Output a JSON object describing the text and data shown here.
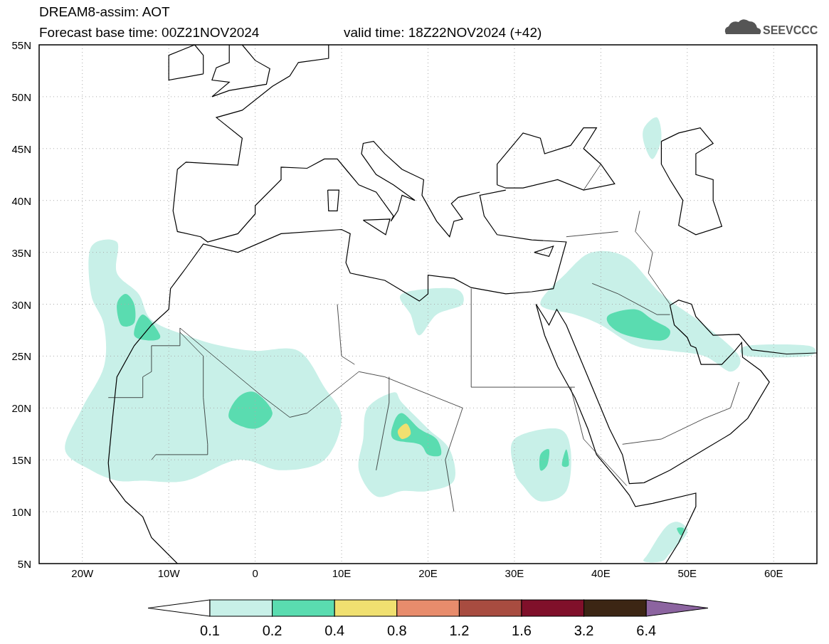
{
  "title": "DREAM8-assim: AOT",
  "base_time": "Forecast base time: 00Z21NOV2024",
  "valid_time": "valid time: 18Z22NOV2024 (+42)",
  "logo": "SEEVCCC",
  "lat_labels": [
    "55N",
    "50N",
    "45N",
    "40N",
    "35N",
    "30N",
    "25N",
    "20N",
    "15N",
    "10N",
    "5N"
  ],
  "lon_labels": [
    "20W",
    "10W",
    "0",
    "10E",
    "20E",
    "30E",
    "40E",
    "50E",
    "60E"
  ],
  "colorbar": {
    "segments": [
      {
        "kind": "under",
        "color": "#ffffff"
      },
      {
        "kind": "box",
        "color": "#c8f0e8"
      },
      {
        "kind": "box",
        "color": "#5adcb0"
      },
      {
        "kind": "box",
        "color": "#f0e070"
      },
      {
        "kind": "box",
        "color": "#e88c6c"
      },
      {
        "kind": "box",
        "color": "#a84c40"
      },
      {
        "kind": "box",
        "color": "#80102a"
      },
      {
        "kind": "box",
        "color": "#3c2614"
      },
      {
        "kind": "over",
        "color": "#8c64a0"
      }
    ],
    "labels": [
      "0.1",
      "0.2",
      "0.4",
      "0.8",
      "1.2",
      "1.6",
      "3.2",
      "6.4"
    ]
  }
}
